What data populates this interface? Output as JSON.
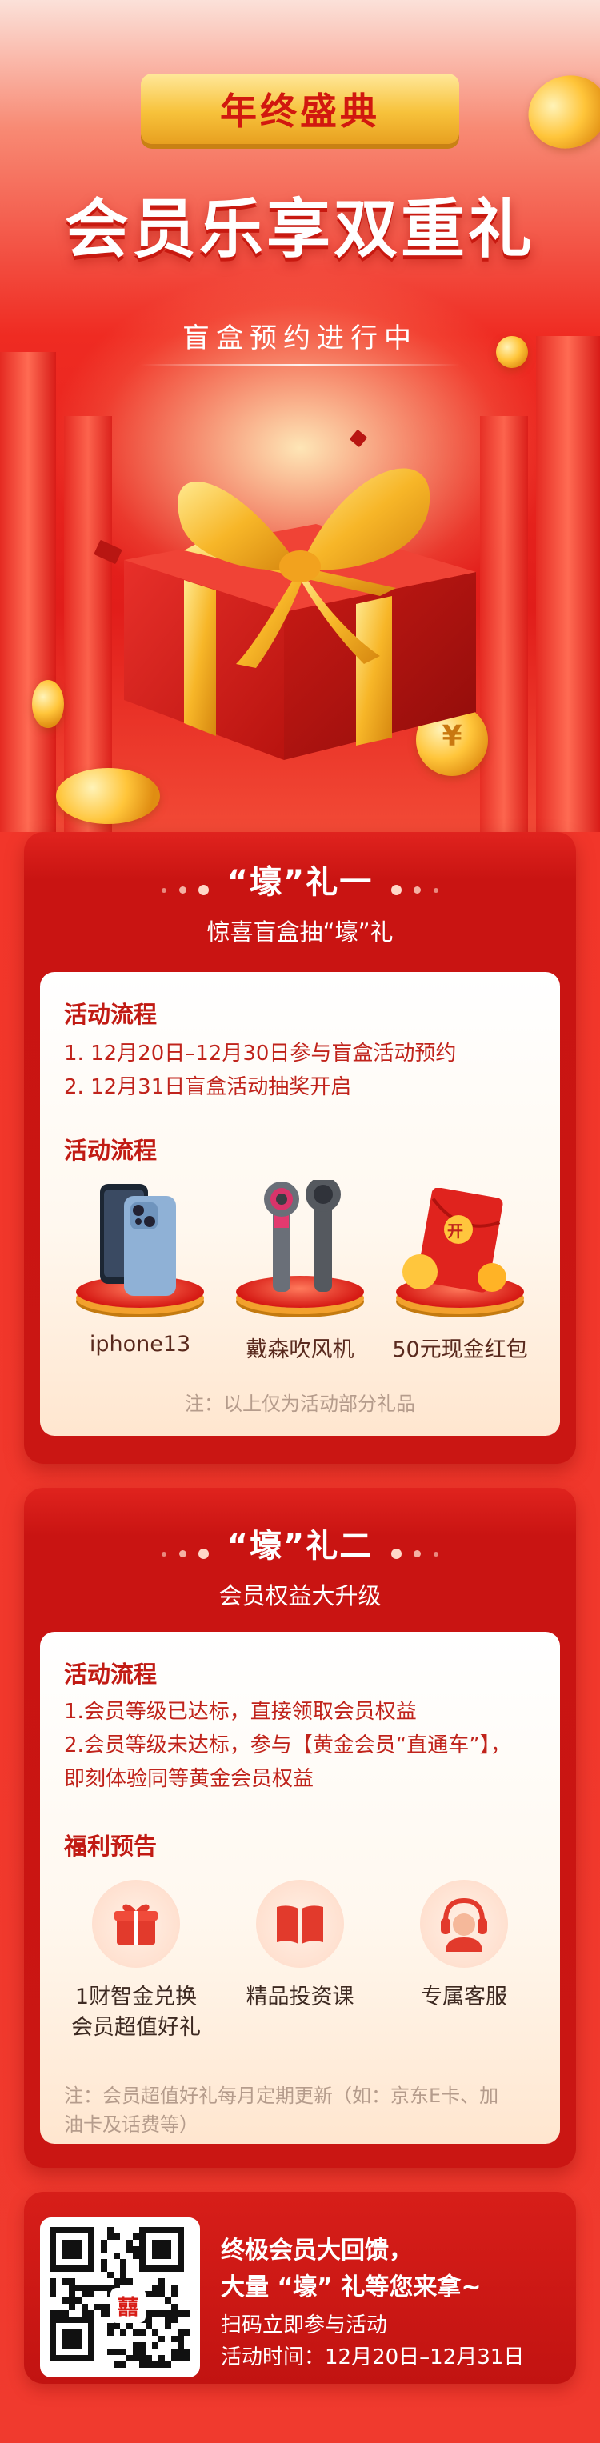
{
  "hero": {
    "badge": "年终盛典",
    "title": "会员乐享双重礼",
    "subtitle": "盲盒预约进行中",
    "coin_glyph": "¥"
  },
  "gift_one": {
    "title": "“壕”礼一",
    "subtitle": "惊喜盲盒抽“壕”礼",
    "process_heading": "活动流程",
    "process_steps": [
      "1. 12月20日–12月30日参与盲盒活动预约",
      "2. 12月31日盲盒活动抽奖开启"
    ],
    "prizes_heading": "活动流程",
    "prizes": [
      {
        "label": "iphone13",
        "icon": "phone-icon"
      },
      {
        "label": "戴森吹风机",
        "icon": "hair-dryer-icon"
      },
      {
        "label": "50元现金红包",
        "icon": "red-envelope-icon"
      }
    ],
    "envelope_glyph": "开",
    "note": "注：以上仅为活动部分礼品"
  },
  "gift_two": {
    "title": "“壕”礼二",
    "subtitle": "会员权益大升级",
    "process_heading": "活动流程",
    "process_steps": [
      "1.会员等级已达标，直接领取会员权益",
      "2.会员等级未达标，参与【黄金会员“直通车”】，",
      "即刻体验同等黄金会员权益"
    ],
    "benefits_heading": "福利预告",
    "benefits": [
      {
        "label_line1": "1财智金兑换",
        "label_line2": "会员超值好礼",
        "icon": "gift-icon"
      },
      {
        "label_line1": "精品投资课",
        "label_line2": "",
        "icon": "book-icon"
      },
      {
        "label_line1": "专属客服",
        "label_line2": "",
        "icon": "headset-icon"
      }
    ],
    "note_line1": "注：会员超值好礼每月定期更新（如：京东E卡、加",
    "note_line2": "油卡及话费等）"
  },
  "bottom": {
    "line1": "终极会员大回馈，",
    "line2": "大量 “壕” 礼等您来拿~",
    "line3": "扫码立即参与活动",
    "line4": "活动时间：12月20日–12月31日",
    "qr_center": "囍"
  },
  "colors": {
    "primary_red": "#d81e18",
    "gold": "#f7c23b",
    "text_red": "#c0231b"
  }
}
